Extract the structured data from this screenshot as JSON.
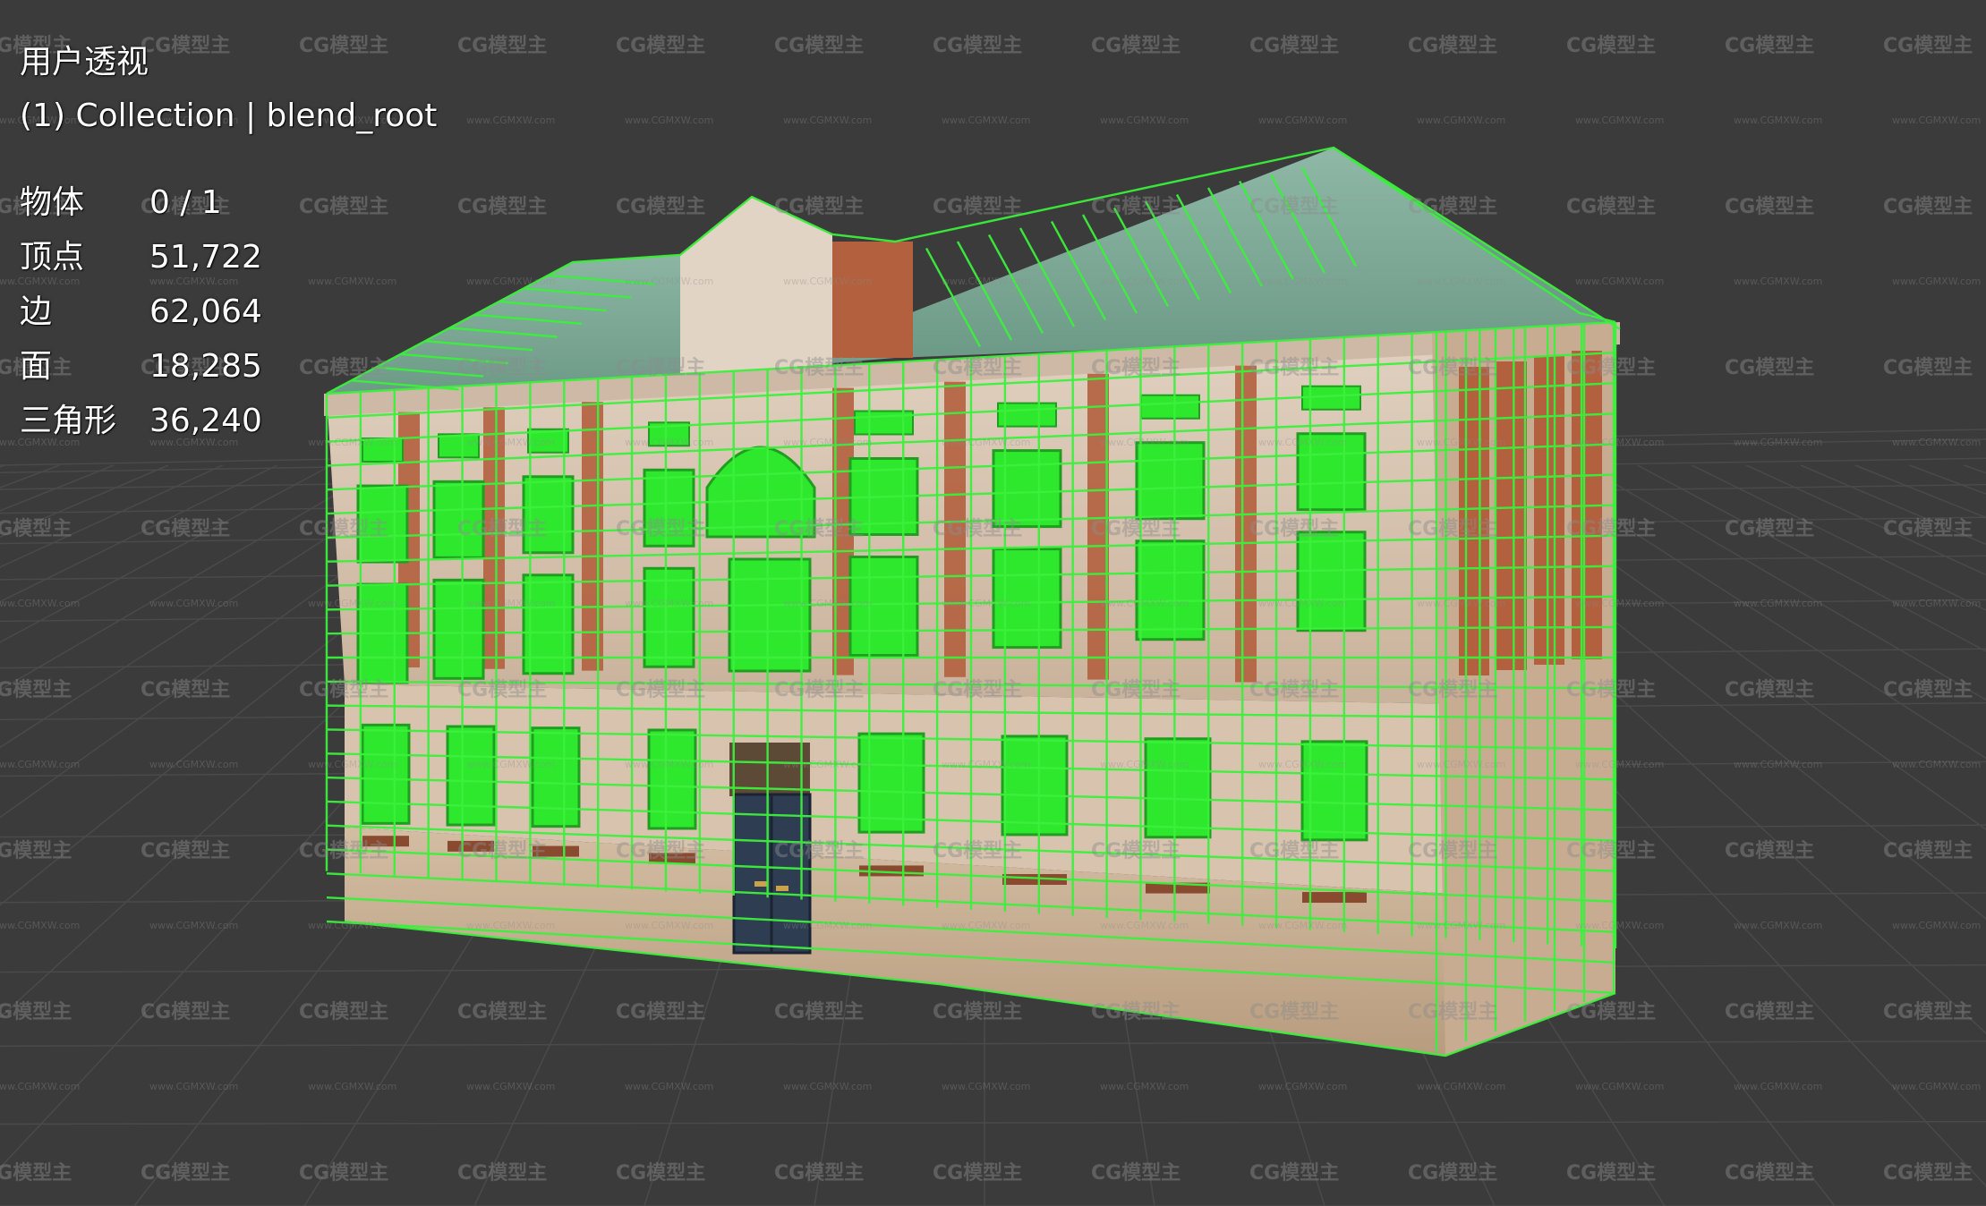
{
  "viewport": {
    "view_name": "用户透视",
    "collection_line": "(1) Collection | blend_root",
    "stats": [
      {
        "label": "物体",
        "value": "0 / 1"
      },
      {
        "label": "顶点",
        "value": "51,722"
      },
      {
        "label": "边",
        "value": "62,064"
      },
      {
        "label": "面",
        "value": "18,285"
      },
      {
        "label": "三角形",
        "value": "36,240"
      }
    ]
  },
  "watermark": {
    "brand": "CG模型主",
    "site": "www.CGMXW.com"
  },
  "colors": {
    "background": "#3b3b3b",
    "grid": "#4a4a4a",
    "wireframe": "#3cf03c",
    "roof": "#7fae9a",
    "stone": "#d9c7b4",
    "brick": "#b2603e",
    "door": "#2f3d52"
  }
}
